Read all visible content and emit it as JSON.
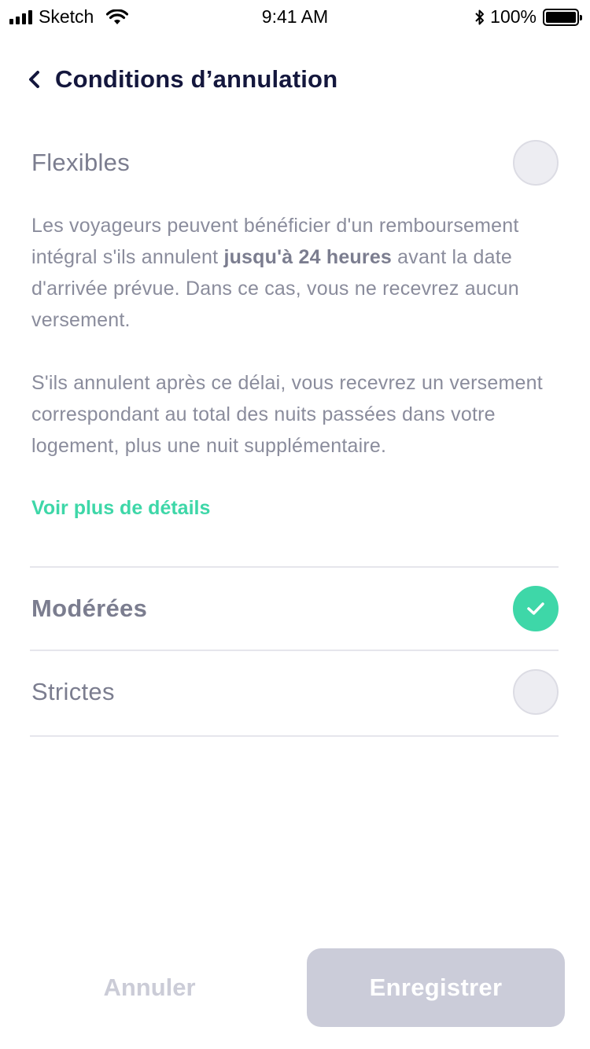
{
  "status_bar": {
    "carrier": "Sketch",
    "time": "9:41 AM",
    "battery": "100%"
  },
  "header": {
    "title": "Conditions d’annulation"
  },
  "options": {
    "flexible": {
      "label": "Flexibles",
      "selected": false,
      "paragraph1_pre": "Les voyageurs peuvent bénéficier d'un remboursement intégral s'ils annulent ",
      "paragraph1_bold": "jusqu'à 24 heures",
      "paragraph1_post": " avant la date d'arrivée prévue. Dans ce cas, vous ne recevrez aucun versement.",
      "paragraph2": "S'ils annulent après ce délai, vous recevrez un versement correspondant au total des nuits passées dans votre logement, plus une nuit supplémentaire.",
      "link": "Voir plus de détails"
    },
    "moderate": {
      "label": "Modérées",
      "selected": true
    },
    "strict": {
      "label": "Strictes",
      "selected": false
    }
  },
  "actions": {
    "cancel": "Annuler",
    "save": "Enregistrer"
  },
  "colors": {
    "accent": "#3ed7a8",
    "title": "#14173d",
    "text": "#7b7d8f",
    "disabled_button": "#cbccd9"
  }
}
